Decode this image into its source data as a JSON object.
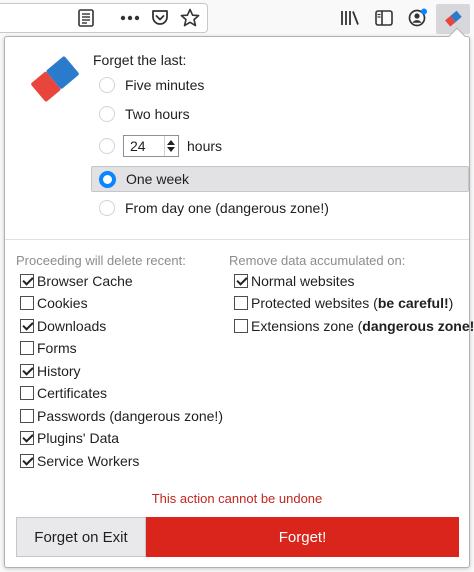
{
  "panel": {
    "forget_title": "Forget the last:",
    "options": [
      {
        "label": "Five minutes",
        "selected": false
      },
      {
        "label": "Two hours",
        "selected": false
      },
      {
        "label": "hours",
        "selected": false,
        "value": "24"
      },
      {
        "label": "One week",
        "selected": true
      },
      {
        "label": "From day one (dangerous zone!)",
        "selected": false
      }
    ],
    "left_section": {
      "title": "Proceeding will delete recent:",
      "items": [
        {
          "label": "Browser Cache",
          "checked": true
        },
        {
          "label": "Cookies",
          "checked": false
        },
        {
          "label": "Downloads",
          "checked": true
        },
        {
          "label": "Forms",
          "checked": false
        },
        {
          "label": "History",
          "checked": true
        },
        {
          "label": "Certificates",
          "checked": false
        },
        {
          "label": "Passwords (dangerous zone!)",
          "checked": false
        },
        {
          "label": "Plugins' Data",
          "checked": true
        },
        {
          "label": "Service Workers",
          "checked": true
        }
      ]
    },
    "right_section": {
      "title": "Remove data accumulated on:",
      "items": [
        {
          "label": "Normal websites",
          "note": "",
          "checked": true
        },
        {
          "label": "Protected websites (",
          "note": "be careful!",
          "tail": ")",
          "checked": false
        },
        {
          "label": "Extensions zone (",
          "note": "dangerous zone!",
          "tail": ")",
          "checked": false
        }
      ]
    },
    "warning": "This action cannot be undone",
    "buttons": {
      "exit": "Forget on Exit",
      "forget": "Forget!"
    }
  },
  "colors": {
    "accent": "#0a84ff",
    "danger": "#d9251b",
    "warning_text": "#c1271f"
  },
  "icons": [
    "reader-view-icon",
    "more-actions-icon",
    "pocket-icon",
    "bookmark-star-icon",
    "library-icon",
    "sidebar-icon",
    "account-icon",
    "eraser-extension-icon"
  ]
}
